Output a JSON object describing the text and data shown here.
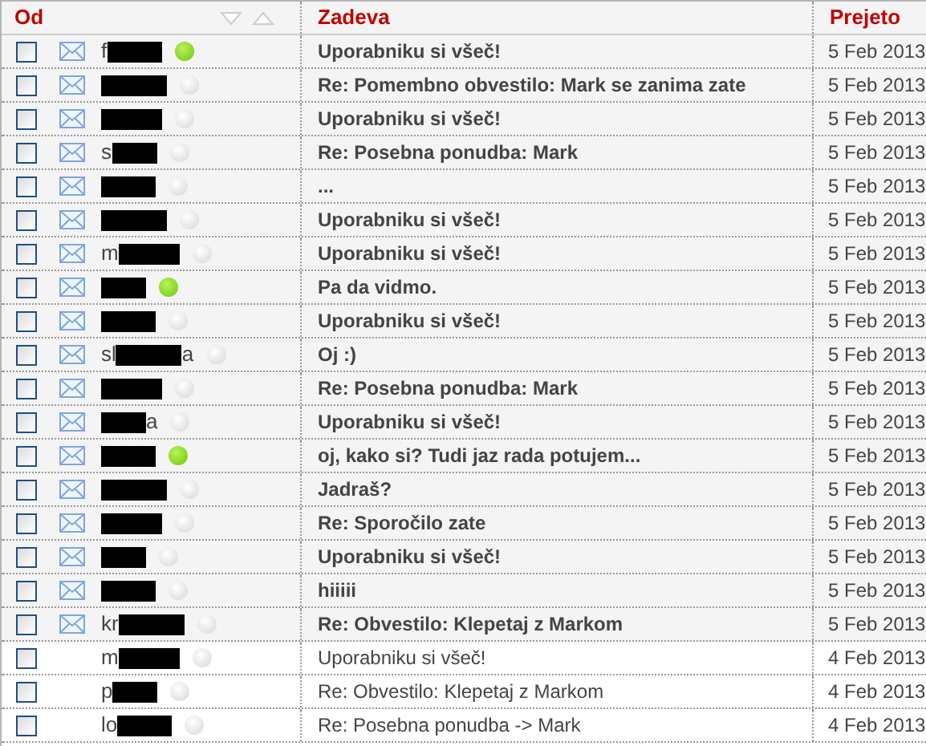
{
  "columns": [
    {
      "label": "Od",
      "sort_arrows": true
    },
    {
      "label": "Zadeva"
    },
    {
      "label": "Prejeto"
    }
  ],
  "rows": [
    {
      "checked": false,
      "unread": true,
      "sender_start": "f",
      "sender_end": "",
      "online": true,
      "subject": "Uporabniku si všeč!",
      "received": "5 Feb 2013"
    },
    {
      "checked": false,
      "unread": true,
      "sender_start": "",
      "sender_end": "",
      "online": false,
      "subject": "Re: Pomembno obvestilo: Mark se zanima zate",
      "received": "5 Feb 2013"
    },
    {
      "checked": false,
      "unread": true,
      "sender_start": "",
      "sender_end": "",
      "online": false,
      "subject": "Uporabniku si všeč!",
      "received": "5 Feb 2013"
    },
    {
      "checked": false,
      "unread": true,
      "sender_start": "s",
      "sender_end": "",
      "online": false,
      "subject": "Re: Posebna ponudba: Mark",
      "received": "5 Feb 2013"
    },
    {
      "checked": false,
      "unread": true,
      "sender_start": "",
      "sender_end": "",
      "online": false,
      "subject": "...",
      "received": "5 Feb 2013"
    },
    {
      "checked": false,
      "unread": true,
      "sender_start": "",
      "sender_end": "",
      "online": false,
      "subject": "Uporabniku si všeč!",
      "received": "5 Feb 2013"
    },
    {
      "checked": false,
      "unread": true,
      "sender_start": "m",
      "sender_end": "",
      "online": false,
      "subject": "Uporabniku si všeč!",
      "received": "5 Feb 2013"
    },
    {
      "checked": false,
      "unread": true,
      "sender_start": "",
      "sender_end": "",
      "online": true,
      "subject": "Pa da vidmo.",
      "received": "5 Feb 2013"
    },
    {
      "checked": false,
      "unread": true,
      "sender_start": "",
      "sender_end": "",
      "online": false,
      "subject": "Uporabniku si všeč!",
      "received": "5 Feb 2013"
    },
    {
      "checked": false,
      "unread": true,
      "sender_start": "sl",
      "sender_end": "a",
      "online": false,
      "subject": "Oj :)",
      "received": "5 Feb 2013"
    },
    {
      "checked": false,
      "unread": true,
      "sender_start": "",
      "sender_end": "",
      "online": false,
      "subject": "Re: Posebna ponudba: Mark",
      "received": "5 Feb 2013"
    },
    {
      "checked": false,
      "unread": true,
      "sender_start": "",
      "sender_end": "a",
      "online": false,
      "subject": "Uporabniku si všeč!",
      "received": "5 Feb 2013"
    },
    {
      "checked": false,
      "unread": true,
      "sender_start": "",
      "sender_end": "",
      "online": true,
      "subject": "oj, kako si? Tudi jaz rada potujem...",
      "received": "5 Feb 2013"
    },
    {
      "checked": false,
      "unread": true,
      "sender_start": "",
      "sender_end": "",
      "online": false,
      "subject": "Jadraš?",
      "received": "5 Feb 2013"
    },
    {
      "checked": false,
      "unread": true,
      "sender_start": "",
      "sender_end": "",
      "online": false,
      "subject": "Re: Sporočilo zate",
      "received": "5 Feb 2013"
    },
    {
      "checked": false,
      "unread": true,
      "sender_start": "",
      "sender_end": "",
      "online": false,
      "subject": "Uporabniku si všeč!",
      "received": "5 Feb 2013"
    },
    {
      "checked": false,
      "unread": true,
      "sender_start": "",
      "sender_end": "",
      "online": false,
      "subject": "hiiiii",
      "received": "5 Feb 2013"
    },
    {
      "checked": false,
      "unread": true,
      "sender_start": "kr",
      "sender_end": "",
      "online": false,
      "subject": "Re: Obvestilo: Klepetaj z Markom",
      "received": "5 Feb 2013"
    },
    {
      "checked": false,
      "unread": false,
      "sender_start": "m",
      "sender_end": "",
      "online": false,
      "subject": "Uporabniku si všeč!",
      "received": "4 Feb 2013"
    },
    {
      "checked": false,
      "unread": false,
      "sender_start": "p",
      "sender_end": "",
      "online": false,
      "subject": "Re: Obvestilo: Klepetaj z Markom",
      "received": "4 Feb 2013"
    },
    {
      "checked": false,
      "unread": false,
      "sender_start": "lo",
      "sender_end": "",
      "online": false,
      "subject": "Re: Posebna ponudba -> Mark",
      "received": "4 Feb 2013"
    }
  ]
}
